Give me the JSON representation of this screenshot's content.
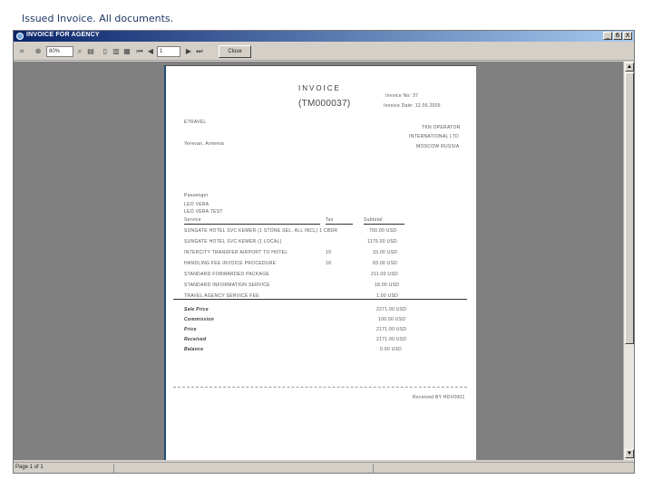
{
  "slide": {
    "caption": "Issued Invoice. All documents."
  },
  "window": {
    "title": "INVOICE FOR AGENCY",
    "buttons": {
      "minimize": "_",
      "maximize": "6",
      "close": "X"
    }
  },
  "toolbar": {
    "zoom_value": "80%",
    "page_value": "1",
    "close_label": "Close"
  },
  "statusbar": {
    "page_text": "Page 1 of 1"
  },
  "invoice": {
    "title": "INVOICE",
    "number": "(TM000037)",
    "meta": [
      "Invoice No: 37",
      "Invoice Date: 12.06.2006"
    ],
    "from_label": "ETRAVEL",
    "to_lines": [
      "TKN OPERATOR",
      "INTERNATIONAL LTD",
      "MOSCOW RUSSIA"
    ],
    "address_label": "Yerevan, Armenia",
    "passenger_label": "Passenger",
    "passengers": [
      "LEO VERA",
      "LEO VERA TEST"
    ],
    "columns": {
      "service": "Service",
      "tax": "Tax",
      "subtotal": "Subtotal"
    },
    "rows": [
      {
        "service": "SUNGATE HOTEL SVC KEMER (1 STONE SEL. ALL INCL) 1 CBDR",
        "tax": "",
        "subtotal": "750.00 USD"
      },
      {
        "service": "SUNGATE HOTEL SVC KEMER (1 LOCAL)",
        "tax": "",
        "subtotal": "1175.00 USD"
      },
      {
        "service": "INTERCITY TRANSFER AIRPORT TO HOTEL",
        "tax": "10",
        "subtotal": "33.00 USD"
      },
      {
        "service": "HANDLING FEE INVOICE PROCEDURE",
        "tax": "18",
        "subtotal": "83.00 USD"
      },
      {
        "service": "STANDARD FORWARDED PACKAGE",
        "tax": "",
        "subtotal": "211.00 USD"
      },
      {
        "service": "STANDARD INFORMATION SERVICE",
        "tax": "",
        "subtotal": "18.00 USD"
      },
      {
        "service": "TRAVEL AGENCY SERVICE FEE",
        "tax": "",
        "subtotal": "1.00 USD"
      }
    ],
    "totals": [
      {
        "label": "Sale Price",
        "value": "2271.00 USD"
      },
      {
        "label": "Commission",
        "value": "100.00 USD"
      },
      {
        "label": "Price",
        "value": "2171.00 USD"
      },
      {
        "label": "Received",
        "value": "2171.00 USD"
      },
      {
        "label": "Balance",
        "value": "0.00 USD"
      }
    ],
    "footer": "Received BY HDV0001"
  }
}
